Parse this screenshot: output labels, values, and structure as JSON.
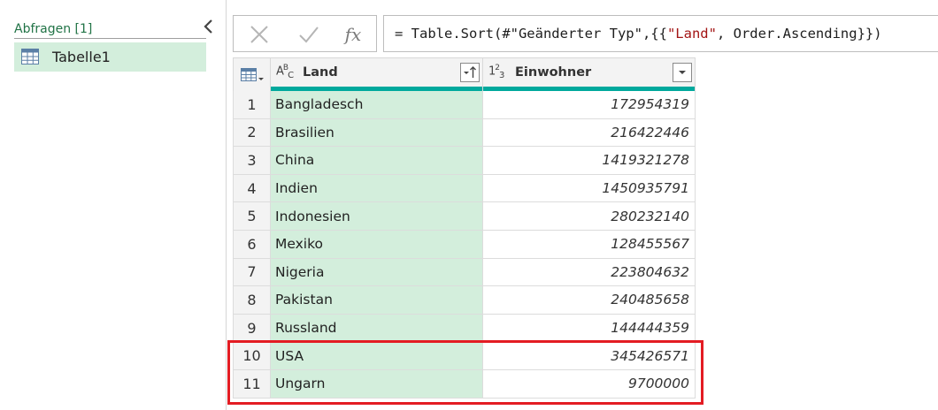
{
  "queries": {
    "title": "Abfragen [1]",
    "items": [
      {
        "label": "Tabelle1",
        "icon": "table-icon"
      }
    ]
  },
  "formula_bar": {
    "cancel_icon": "close-icon",
    "commit_icon": "checkmark-icon",
    "fx_label": "fx",
    "prefix": "= Table.Sort(#\"Geänderter Typ\",{{",
    "string_literal": "\"Land\"",
    "suffix": ", Order.Ascending}})"
  },
  "grid": {
    "columns": [
      {
        "type_icon": "ABC",
        "name": "Land",
        "sorted": "ascending"
      },
      {
        "type_icon": "123",
        "name": "Einwohner"
      }
    ],
    "rows": [
      {
        "num": "1",
        "land": "Bangladesch",
        "einwohner": "172954319"
      },
      {
        "num": "2",
        "land": "Brasilien",
        "einwohner": "216422446"
      },
      {
        "num": "3",
        "land": "China",
        "einwohner": "1419321278"
      },
      {
        "num": "4",
        "land": "Indien",
        "einwohner": "1450935791"
      },
      {
        "num": "5",
        "land": "Indonesien",
        "einwohner": "280232140"
      },
      {
        "num": "6",
        "land": "Mexiko",
        "einwohner": "128455567"
      },
      {
        "num": "7",
        "land": "Nigeria",
        "einwohner": "223804632"
      },
      {
        "num": "8",
        "land": "Pakistan",
        "einwohner": "240485658"
      },
      {
        "num": "9",
        "land": "Russland",
        "einwohner": "144444359"
      },
      {
        "num": "10",
        "land": "USA",
        "einwohner": "345426571"
      },
      {
        "num": "11",
        "land": "Ungarn",
        "einwohner": "9700000"
      }
    ]
  },
  "colors": {
    "accent_green": "#217346",
    "selection_green": "#d3eedc",
    "quality_bar": "#00a99d",
    "highlight_red": "#e31c23"
  }
}
